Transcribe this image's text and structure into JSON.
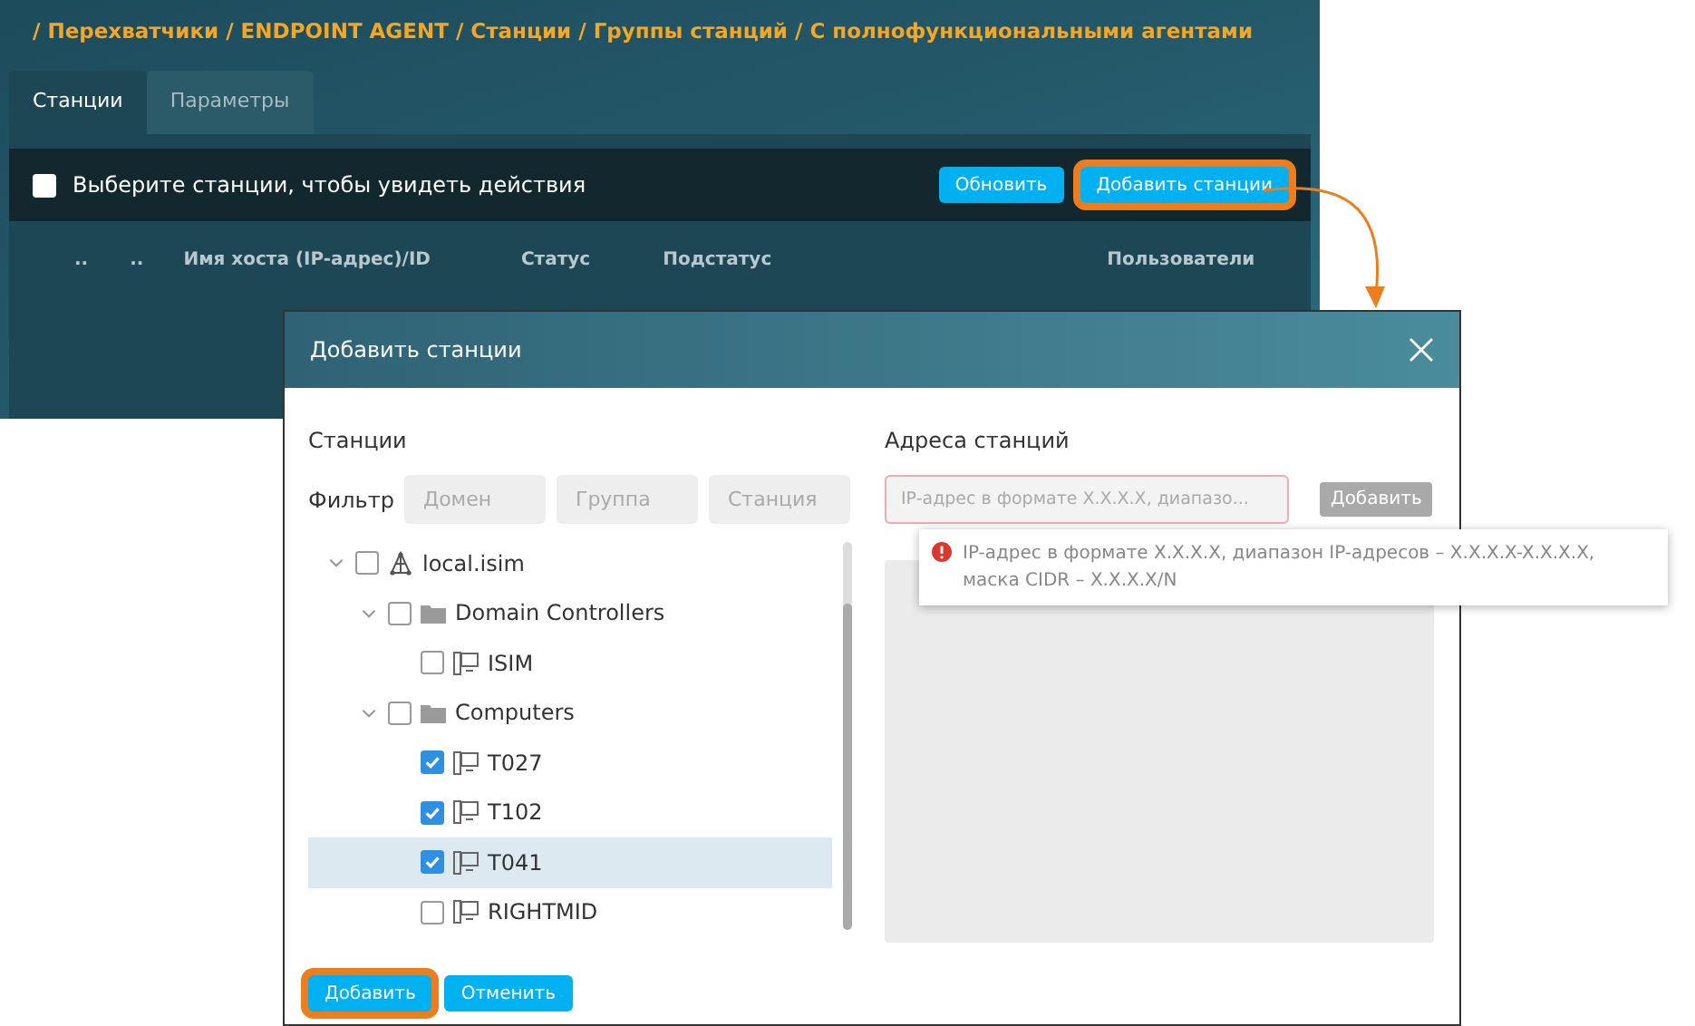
{
  "background": {
    "breadcrumb": "/ Перехватчики / ENDPOINT AGENT / Станции / Группы станций / С полнофункциональными агентами",
    "tabs": [
      {
        "label": "Станции",
        "selected": true
      },
      {
        "label": "Параметры",
        "selected": false
      }
    ],
    "toolbar": {
      "select_all": {
        "label": "Выберите станции, чтобы увидеть действия",
        "checked": false
      },
      "buttons": [
        {
          "label": "Обновить",
          "highlighted": false
        },
        {
          "label": "Добавить станции",
          "highlighted": true
        }
      ]
    },
    "columns": [
      "..",
      "..",
      "Имя хоста (IP-адрес)/ID",
      "Статус",
      "Подстатус",
      "Пользователи"
    ]
  },
  "dialog": {
    "title": "Добавить станции",
    "stations_label": "Станции",
    "filter_label": "Фильтр",
    "filters": [
      {
        "placeholder": "Домен"
      },
      {
        "placeholder": "Группа"
      },
      {
        "placeholder": "Станция"
      }
    ],
    "tree": [
      {
        "kind": "domain",
        "label": "local.isim",
        "checked": false,
        "expanded": true,
        "selected": false,
        "children": [
          {
            "kind": "folder",
            "label": "Domain Controllers",
            "checked": false,
            "expanded": true,
            "selected": false,
            "children": [
              {
                "kind": "computer",
                "label": "ISIM",
                "checked": false,
                "selected": false
              }
            ]
          },
          {
            "kind": "folder",
            "label": "Computers",
            "checked": false,
            "expanded": true,
            "selected": false,
            "children": [
              {
                "kind": "computer",
                "label": "T027",
                "checked": true,
                "selected": false
              },
              {
                "kind": "computer",
                "label": "T102",
                "checked": true,
                "selected": false
              },
              {
                "kind": "computer",
                "label": "T041",
                "checked": true,
                "selected": true
              },
              {
                "kind": "computer",
                "label": "RIGHTMID",
                "checked": false,
                "selected": false
              }
            ]
          }
        ]
      }
    ],
    "addresses_label": "Адреса станций",
    "address_field": {
      "placeholder": "IP-адрес в формате X.X.X.X, диапазо...",
      "invalid": true
    },
    "add_address_button": {
      "label": "Добавить",
      "disabled": true
    },
    "error_tooltip": "IP-адрес в формате X.X.X.X, диапазон IP-адресов – X.X.X.X-X.X.X.X, маска CIDR – X.X.X.X/N",
    "buttons": [
      {
        "label": "Добавить",
        "highlighted": true
      },
      {
        "label": "Отменить",
        "highlighted": false
      }
    ]
  }
}
